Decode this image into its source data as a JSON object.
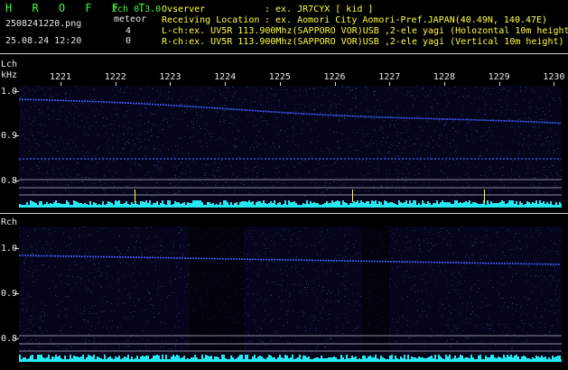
{
  "header": {
    "logo": "H R O F F T",
    "filename": "2508241220.png",
    "datetime": "25.08.24 12:20",
    "channels_label": "2ch 0.3.0",
    "meteor_label": "meteor",
    "count_l": "4",
    "count_r": "0",
    "observer_label": "Ovserver",
    "observer_value": ": ex. JR7CYX [ kid ]",
    "location_label": "Receiving Location",
    "location_value": ": ex. Aomori City Aomori-Pref.JAPAN(40.49N, 140.47E)",
    "lch_info": "L-ch:ex. UV5R 113.900Mhz(SAPPORO VOR)USB ,2-ele yagi (Holozontal 10m height)",
    "rch_info": "R-ch:ex. UV5R 113.900Mhz(SAPPORO VOR)USB ,2-ele yagi (Vertical 10m height)"
  },
  "time_axis": [
    "1221",
    "1222",
    "1223",
    "1224",
    "1225",
    "1226",
    "1227",
    "1228",
    "1229",
    "1230"
  ],
  "lch": {
    "label": "Lch",
    "unit": "kHz",
    "freq_ticks": [
      "1.0",
      "0.9",
      "0.8"
    ]
  },
  "rch": {
    "label": "Rch",
    "freq_ticks": [
      "1.0",
      "0.9",
      "0.8"
    ]
  },
  "colors": {
    "text_green": "#3cff3c",
    "text_yellow": "#ffff40",
    "trace_blue": "#3f5cff",
    "noise_cyan": "#25e8f0",
    "background": "#000000"
  }
}
